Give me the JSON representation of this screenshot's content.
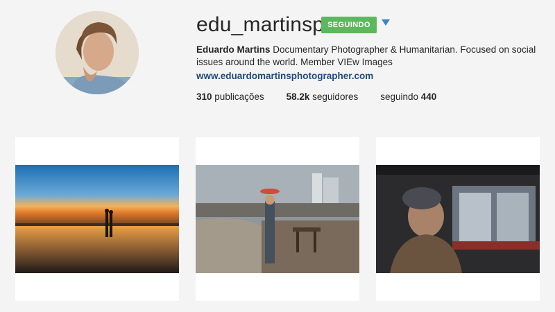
{
  "profile": {
    "username": "edu_martinsp",
    "follow_label": "SEGUINDO",
    "full_name": "Eduardo Martins",
    "bio": "Documentary Photographer & Humanitarian. Focused on social issues around the world. Member VIEw Images",
    "website": "www.eduardomartinsphotographer.com"
  },
  "stats": {
    "posts_count": "310",
    "posts_label": "publicações",
    "followers_count": "58.2k",
    "followers_label": "seguidores",
    "following_label": "seguindo",
    "following_count": "440"
  },
  "colors": {
    "follow_button": "#5cb85c",
    "link": "#1e4a7a",
    "dropdown": "#3b83c9",
    "background": "#f4f4f4"
  },
  "icons": {
    "dropdown": "triangle-down-icon"
  }
}
